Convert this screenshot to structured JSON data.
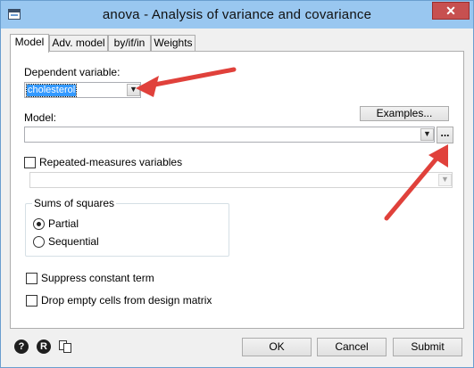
{
  "window": {
    "title": "anova - Analysis of variance and covariance",
    "close_glyph": "✕"
  },
  "tabs": [
    {
      "label": "Model",
      "active": true
    },
    {
      "label": "Adv. model",
      "active": false
    },
    {
      "label": "by/if/in",
      "active": false
    },
    {
      "label": "Weights",
      "active": false
    }
  ],
  "model_tab": {
    "dependent_variable_label": "Dependent variable:",
    "dependent_variable_value": "cholesterol",
    "model_label": "Model:",
    "model_value": "",
    "examples_button": "Examples...",
    "browse_button": "...",
    "repeated_measures_label": "Repeated-measures variables",
    "repeated_measures_checked": false,
    "repeated_measures_value": "",
    "sums_of_squares": {
      "title": "Sums of squares",
      "options": [
        {
          "label": "Partial",
          "selected": true
        },
        {
          "label": "Sequential",
          "selected": false
        }
      ]
    },
    "suppress_constant_label": "Suppress constant term",
    "suppress_constant_checked": false,
    "drop_empty_cells_label": "Drop empty cells from design matrix",
    "drop_empty_cells_checked": false
  },
  "footer": {
    "help_icon_glyph": "?",
    "reset_icon_glyph": "R",
    "ok_button": "OK",
    "cancel_button": "Cancel",
    "submit_button": "Submit"
  },
  "colors": {
    "titlebar": "#99c7f0",
    "close_button": "#c75050",
    "selection": "#3399ff",
    "annotation_arrow": "#e0413b"
  },
  "icons": {
    "app": "stata-window-icon",
    "close": "close-icon",
    "dropdown": "chevron-down-icon",
    "help": "help-icon",
    "reset": "reset-icon",
    "copy": "copy-command-icon"
  }
}
